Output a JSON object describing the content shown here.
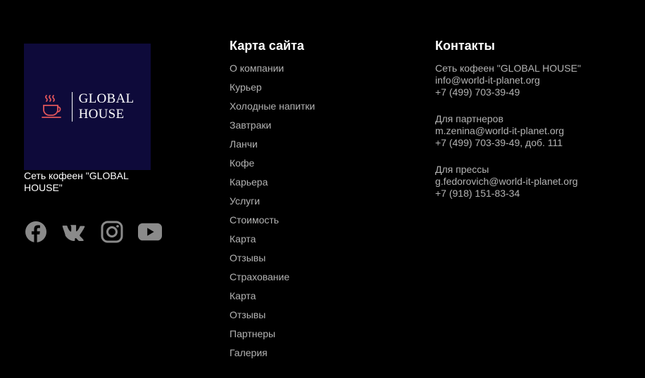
{
  "brand": {
    "logo_line1": "GLOBAL",
    "logo_line2": "HOUSE",
    "logo_bg": "#0e0a3a",
    "cup_color": "#e0555b",
    "caption": "Сеть кофеен \"GLOBAL HOUSE\""
  },
  "socials": [
    {
      "name": "facebook",
      "icon": "facebook-icon"
    },
    {
      "name": "vk",
      "icon": "vk-icon"
    },
    {
      "name": "instagram",
      "icon": "instagram-icon"
    },
    {
      "name": "youtube",
      "icon": "youtube-icon"
    }
  ],
  "sitemap": {
    "title": "Карта сайта",
    "items": [
      "О компании",
      "Курьер",
      "Холодные напитки",
      "Завтраки",
      "Ланчи",
      "Кофе",
      "Карьера",
      "Услуги",
      "Стоимость",
      "Карта",
      "Отзывы",
      "Страхование",
      "Карта",
      "Отзывы",
      "Партнеры",
      "Галерия"
    ]
  },
  "contacts": {
    "title": "Контакты",
    "blocks": [
      {
        "label": "Сеть кофеен \"GLOBAL HOUSE\"",
        "email": "info@world-it-planet.org",
        "phone": "+7 (499) 703-39-49"
      },
      {
        "label": "Для партнеров",
        "email": "m.zenina@world-it-planet.org",
        "phone": "+7 (499) 703-39-49, доб. 111"
      },
      {
        "label": "Для прессы",
        "email": "g.fedorovich@world-it-planet.org",
        "phone": "+7 (918) 151-83-34"
      }
    ]
  },
  "colors": {
    "background": "#000000",
    "link": "#b3b3b3",
    "heading": "#ffffff",
    "icon": "#8a8a8a"
  }
}
